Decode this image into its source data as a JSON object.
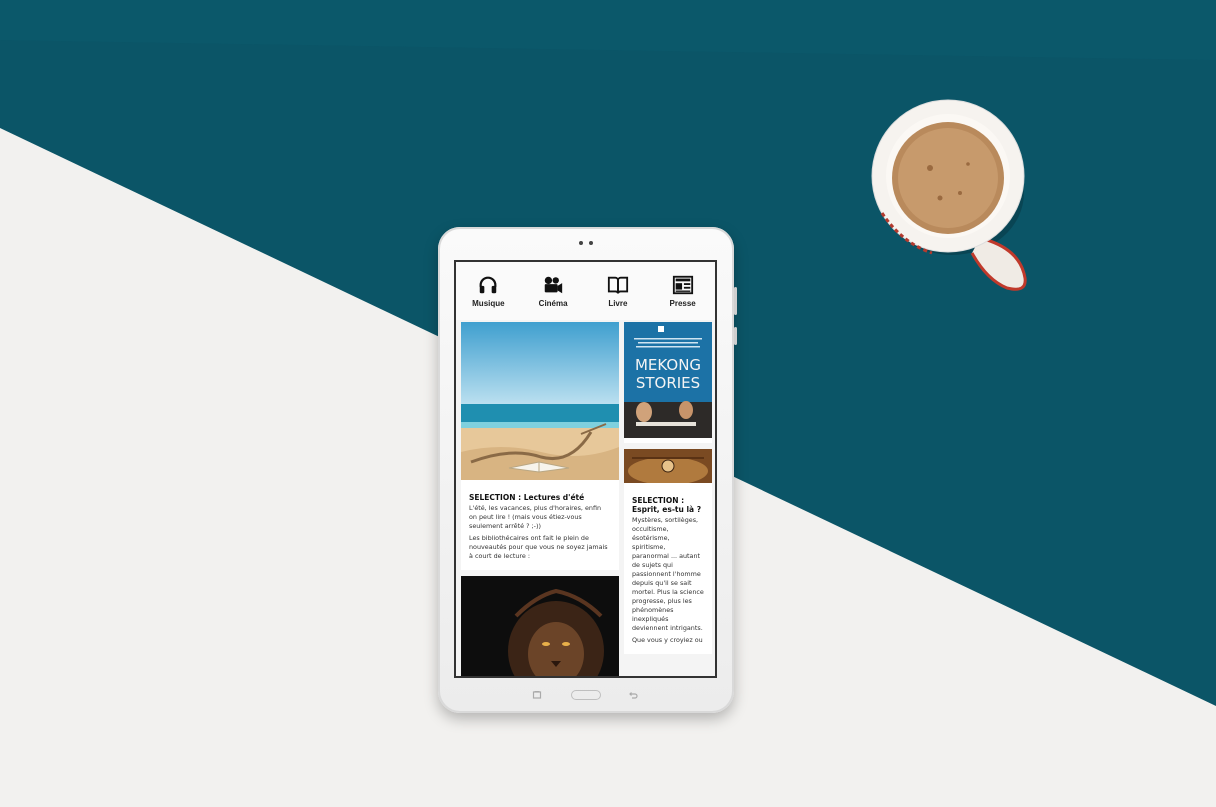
{
  "colors": {
    "teal": "#0b5567",
    "white_surface": "#f2f1ef",
    "tablet_body": "#f4f4f4"
  },
  "nav": {
    "items": [
      {
        "label": "Musique",
        "icon": "headphones-icon"
      },
      {
        "label": "Cinéma",
        "icon": "film-camera-icon"
      },
      {
        "label": "Livre",
        "icon": "open-book-icon"
      },
      {
        "label": "Presse",
        "icon": "newspaper-icon"
      }
    ]
  },
  "cards": {
    "summer": {
      "title": "SELECTION : Lectures d'été",
      "body1": "L'été, les vacances, plus d'horaires, enfin on peut lire ! (mais vous étiez-vous seulement arrêté ? ;-))",
      "body2": "Les bibliothécaires ont fait le plein de nouveautés pour que vous ne soyez jamais à court de lecture :"
    },
    "poster": {
      "title_line1": "MEKONG",
      "title_line2": "STORIES"
    },
    "esprit": {
      "title": "SELECTION : Esprit, es-tu là ?",
      "body1": "Mystères, sortilèges, occultisme, ésotérisme, spiritisme, paranormal ... autant de sujets qui passionnent l'homme depuis qu'il se sait mortel. Plus la science progresse, plus les phénomènes inexpliqués deviennent intrigants.",
      "body2": "Que vous y croyiez ou"
    }
  }
}
